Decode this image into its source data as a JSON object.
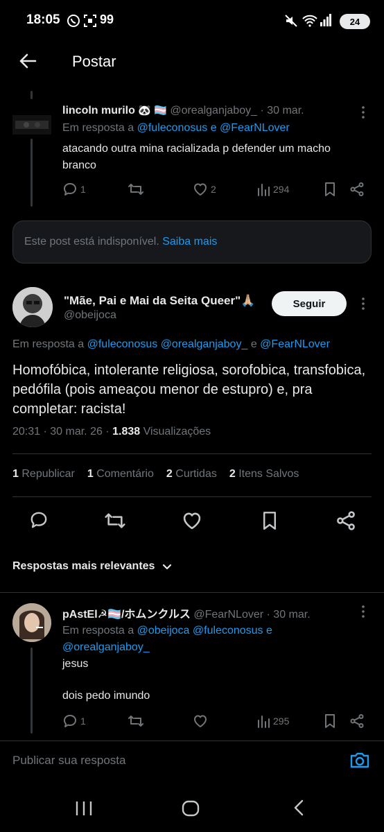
{
  "status": {
    "time": "18:05",
    "notif_count": "99",
    "battery": "24"
  },
  "header": {
    "title": "Postar"
  },
  "reply1": {
    "name": "lincoln murilo",
    "name_emoji": "🐼 🏳️‍⚧️",
    "handle": "@orealganjaboy_",
    "date": "· 30 mar.",
    "reply_prefix": "Em resposta a",
    "reply_to": "@fuleconosus e @FearNLover",
    "text": "atacando outra mina racializada p defender um macho branco",
    "comments": "1",
    "likes": "2",
    "views": "294"
  },
  "unavailable": {
    "text": "Este post está indisponível.",
    "link": "Saiba mais"
  },
  "main_post": {
    "name": "\"Mãe, Pai e Mai da Seita Queer\"🙏🏼",
    "handle": "@obeijoca",
    "follow_label": "Seguir",
    "reply_prefix": "Em resposta a",
    "reply_to_a": "@fuleconosus @orealganjaboy_",
    "reply_and": "e",
    "reply_to_b": "@FearNLover",
    "text": "Homofóbica, intolerante religiosa, sorofobica, transfobica, pedófila (pois ameaçou menor de estupro) e, pra completar: racista!",
    "timestamp": "20:31 · 30 mar. 26 ·",
    "views_count": "1.838",
    "views_label": "Visualizações",
    "stats": [
      {
        "count": "1",
        "label": "Republicar"
      },
      {
        "count": "1",
        "label": "Comentário"
      },
      {
        "count": "2",
        "label": "Curtidas"
      },
      {
        "count": "2",
        "label": "Itens Salvos"
      }
    ]
  },
  "replies_header": {
    "label": "Respostas mais relevantes"
  },
  "reply2": {
    "name": "pAstEl☭🏳️‍⚧️/ホムンクルス",
    "handle": "@FearNLover",
    "date": "· 30 mar.",
    "reply_prefix": "Em resposta a",
    "reply_to_line1": "@obeijoca @fuleconosus e",
    "reply_to_line2": "@orealganjaboy_",
    "text_line1": "jesus",
    "text_line2": "dois pedo imundo",
    "comments": "1",
    "views": "295"
  },
  "composer": {
    "placeholder": "Publicar sua resposta"
  },
  "colors": {
    "accent": "#1d9bf0",
    "muted": "#71767b",
    "text": "#e7e9ea",
    "bg": "#000000"
  }
}
